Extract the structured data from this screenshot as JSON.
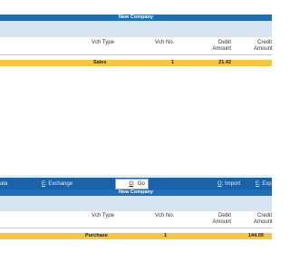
{
  "top_panel": {
    "title": "New Company",
    "columns": {
      "vch_type": "Vch Type",
      "vch_no": "Vch No.",
      "debit": "Debit",
      "debit_sub": "Amount",
      "credit": "Credit",
      "credit_sub": "Amount"
    },
    "selected_row": {
      "vch_type": "Sales",
      "vch_no": "1",
      "debit": "21.42",
      "credit": ""
    }
  },
  "button_bar": {
    "data": "ata",
    "exchange": "Exchange",
    "exchange_key": "E",
    "goto": "Go To",
    "goto_key": "G",
    "import": "Import",
    "import_key": "O",
    "export": "Exp",
    "export_key": "E"
  },
  "bottom_panel": {
    "title": "New Company",
    "columns": {
      "vch_type": "Vch Type",
      "vch_no": "Vch No.",
      "debit": "Debit",
      "debit_sub": "Amount",
      "credit": "Credit",
      "credit_sub": "Amount"
    },
    "selected_row": {
      "vch_type": "Purchase",
      "vch_no": "1",
      "debit": "",
      "credit": "144.00"
    }
  },
  "colors": {
    "title_bar": "#1f6fb6",
    "selection": "#f7c73a",
    "button_bar": "#1a63a8"
  }
}
